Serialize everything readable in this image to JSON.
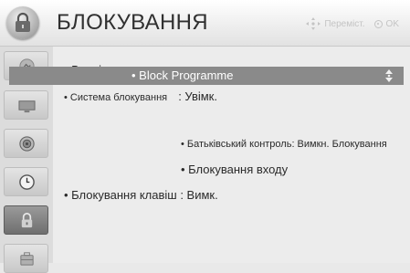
{
  "header": {
    "title": "БЛОКУВАННЯ",
    "hint_move": "Переміст.",
    "hint_ok": "OK",
    "icon": "lock-menu-icon"
  },
  "sidebar": {
    "items": [
      {
        "icon": "picture-icon"
      },
      {
        "icon": "display-icon"
      },
      {
        "icon": "speaker-icon"
      },
      {
        "icon": "clock-icon"
      },
      {
        "icon": "lock-icon",
        "active": true
      },
      {
        "icon": "option-icon"
      }
    ]
  },
  "menu": {
    "enter_password": "• Введіть пароль",
    "lock_system": "• Система блокування",
    "lock_system_value": ": Увімк.",
    "block_programme": "• Block Programme",
    "parental_control": "• Батьківський контроль: Вимкн. Блокування",
    "input_lock": "• Блокування входу",
    "key_lock": "• Блокування клавіш : Вимк."
  }
}
